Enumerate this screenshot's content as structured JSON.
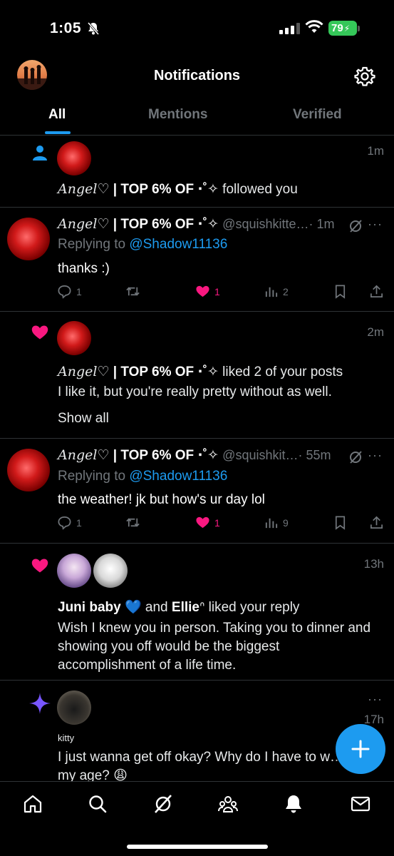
{
  "status_bar": {
    "time": "1:05",
    "battery": "79"
  },
  "header": {
    "title": "Notifications"
  },
  "tabs": [
    {
      "label": "All"
    },
    {
      "label": "Mentions"
    },
    {
      "label": "Verified"
    }
  ],
  "notifications": [
    {
      "type": "follow",
      "time": "1m",
      "name": "Angel♡",
      "badge": " | TOP 6% OF ⋅˚✧",
      "action": " followed you"
    },
    {
      "type": "reply",
      "name": "Angel♡",
      "badge": " | TOP 6% OF ⋅˚✧",
      "handle": "@squishkitte…",
      "time": "· 1m",
      "replying_prefix": "Replying to ",
      "replying_to": "@Shadow11136",
      "text": "thanks :)",
      "replies": "1",
      "likes": "1",
      "views": "2"
    },
    {
      "type": "like",
      "time": "2m",
      "name": "Angel♡",
      "badge": " | TOP 6% OF ⋅˚✧",
      "action": " liked 2 of your posts",
      "preview": "I like it, but you're really pretty without as well.",
      "show_all": "Show all"
    },
    {
      "type": "reply",
      "name": "Angel♡",
      "badge": " | TOP 6% OF ⋅˚✧",
      "handle": "@squishkit…",
      "time": "· 55m",
      "replying_prefix": "Replying to ",
      "replying_to": "@Shadow11136",
      "text": "the weather! jk but how's ur day lol",
      "replies": "1",
      "likes": "1",
      "views": "9"
    },
    {
      "type": "like",
      "time": "13h",
      "user1": "Juni baby 💙",
      "joiner": " and ",
      "user2": "Ellie",
      "user2_symbol": "ᐢ",
      "action": " liked your reply",
      "preview": "Wish I knew you in person. Taking you to dinner and showing you off would be the biggest accomplishment of a life time."
    },
    {
      "type": "highlight",
      "time": "17h",
      "name": "kitty",
      "preview": "I just wanna get off okay? Why do I have to w… my age? 😩"
    }
  ],
  "icons": {
    "accent": "#1d9bf0",
    "like": "#f91880",
    "follow": "#1d9bf0",
    "sparkle": "#7856ff"
  }
}
